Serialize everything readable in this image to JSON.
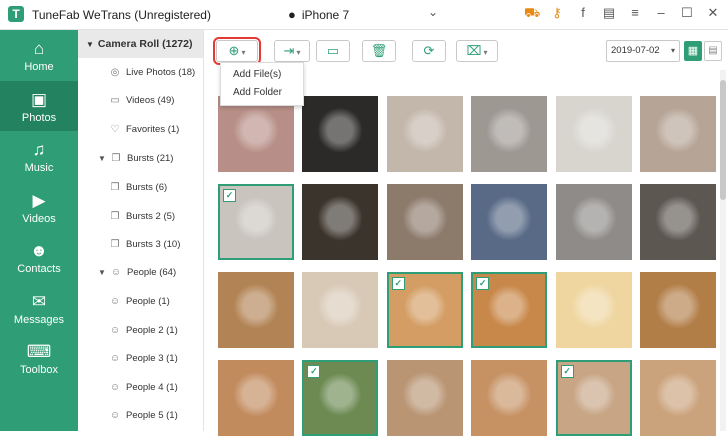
{
  "app": {
    "title": "TuneFab WeTrans (Unregistered)",
    "device": "iPhone 7"
  },
  "topbar_icons": [
    "cart-icon",
    "key-icon",
    "facebook-icon",
    "feedback-icon",
    "menu-icon",
    "minimize-icon",
    "maximize-icon",
    "close-icon"
  ],
  "nav": [
    {
      "label": "Home",
      "icon": "home-icon",
      "glyph": "⌂"
    },
    {
      "label": "Photos",
      "icon": "photo-icon",
      "glyph": "▣"
    },
    {
      "label": "Music",
      "icon": "music-icon",
      "glyph": "♫"
    },
    {
      "label": "Videos",
      "icon": "video-icon",
      "glyph": "▶"
    },
    {
      "label": "Contacts",
      "icon": "contacts-icon",
      "glyph": "☻"
    },
    {
      "label": "Messages",
      "icon": "messages-icon",
      "glyph": "✉"
    },
    {
      "label": "Toolbox",
      "icon": "toolbox-icon",
      "glyph": "⌨"
    }
  ],
  "tree": {
    "root": "Camera Roll (1272)",
    "items": [
      {
        "label": "Live Photos (18)",
        "icon": "live-photo-icon",
        "glyph": "◎",
        "group": false
      },
      {
        "label": "Videos (49)",
        "icon": "video-icon",
        "glyph": "▭",
        "group": false
      },
      {
        "label": "Favorites (1)",
        "icon": "heart-icon",
        "glyph": "♡",
        "group": false
      },
      {
        "label": "Bursts (21)",
        "icon": "burst-icon",
        "glyph": "❐",
        "group": true
      },
      {
        "label": "Bursts (6)",
        "icon": "burst-icon",
        "glyph": "❐",
        "group": false
      },
      {
        "label": "Bursts 2 (5)",
        "icon": "burst-icon",
        "glyph": "❐",
        "group": false
      },
      {
        "label": "Bursts 3 (10)",
        "icon": "burst-icon",
        "glyph": "❐",
        "group": false
      },
      {
        "label": "People (64)",
        "icon": "people-icon",
        "glyph": "☺",
        "group": true
      },
      {
        "label": "People (1)",
        "icon": "people-icon",
        "glyph": "☺",
        "group": false
      },
      {
        "label": "People 2 (1)",
        "icon": "people-icon",
        "glyph": "☺",
        "group": false
      },
      {
        "label": "People 3 (1)",
        "icon": "people-icon",
        "glyph": "☺",
        "group": false
      },
      {
        "label": "People 4 (1)",
        "icon": "people-icon",
        "glyph": "☺",
        "group": false
      },
      {
        "label": "People 5 (1)",
        "icon": "people-icon",
        "glyph": "☺",
        "group": false
      }
    ]
  },
  "toolbar": {
    "date": "2019-07-02",
    "add_menu": [
      "Add File(s)",
      "Add Folder"
    ]
  },
  "photos": [
    {
      "bg": "#b88f88",
      "sel": false
    },
    {
      "bg": "#2b2a28",
      "sel": false
    },
    {
      "bg": "#c3b6aa",
      "sel": false
    },
    {
      "bg": "#9e9893",
      "sel": false
    },
    {
      "bg": "#d8d5cf",
      "sel": false
    },
    {
      "bg": "#b6a496",
      "sel": false
    },
    {
      "bg": "#c9c4bd",
      "sel": true
    },
    {
      "bg": "#3b342c",
      "sel": false
    },
    {
      "bg": "#8c7a6b",
      "sel": false
    },
    {
      "bg": "#586a86",
      "sel": false
    },
    {
      "bg": "#8e8b88",
      "sel": false
    },
    {
      "bg": "#5d5752",
      "sel": false
    },
    {
      "bg": "#b28354",
      "sel": false
    },
    {
      "bg": "#d8c9b6",
      "sel": false
    },
    {
      "bg": "#d39d63",
      "sel": true
    },
    {
      "bg": "#c8884a",
      "sel": true
    },
    {
      "bg": "#efd6a0",
      "sel": false
    },
    {
      "bg": "#b27e48",
      "sel": false
    },
    {
      "bg": "#c28b5e",
      "sel": false
    },
    {
      "bg": "#6c8a52",
      "sel": true
    },
    {
      "bg": "#b99574",
      "sel": false
    },
    {
      "bg": "#c69264",
      "sel": false
    },
    {
      "bg": "#c7a585",
      "sel": true
    },
    {
      "bg": "#caa27b",
      "sel": false
    }
  ]
}
